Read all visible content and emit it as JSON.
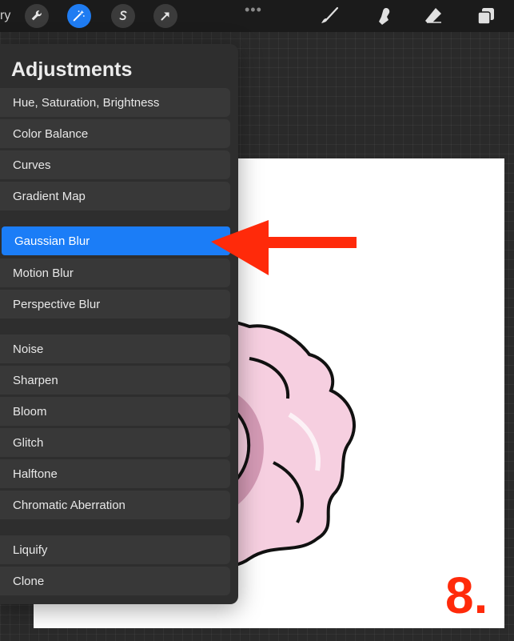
{
  "topbar": {
    "gallery_stub": "ry",
    "more_dots": "•••"
  },
  "adjustments": {
    "title": "Adjustments",
    "items": [
      {
        "label": "Hue, Saturation, Brightness",
        "selected": false
      },
      {
        "label": "Color Balance",
        "selected": false
      },
      {
        "label": "Curves",
        "selected": false
      },
      {
        "label": "Gradient Map",
        "selected": false
      },
      {
        "label": "Gaussian Blur",
        "selected": true
      },
      {
        "label": "Motion Blur",
        "selected": false
      },
      {
        "label": "Perspective Blur",
        "selected": false
      },
      {
        "label": "Noise",
        "selected": false
      },
      {
        "label": "Sharpen",
        "selected": false
      },
      {
        "label": "Bloom",
        "selected": false
      },
      {
        "label": "Glitch",
        "selected": false
      },
      {
        "label": "Halftone",
        "selected": false
      },
      {
        "label": "Chromatic Aberration",
        "selected": false
      },
      {
        "label": "Liquify",
        "selected": false
      },
      {
        "label": "Clone",
        "selected": false
      }
    ]
  },
  "annotation": {
    "step_number": "8."
  },
  "colors": {
    "accent": "#1b7df7",
    "arrow": "#ff2a0a",
    "rose_fill": "#f6cfe0",
    "rose_shadow": "#d49ab5"
  }
}
